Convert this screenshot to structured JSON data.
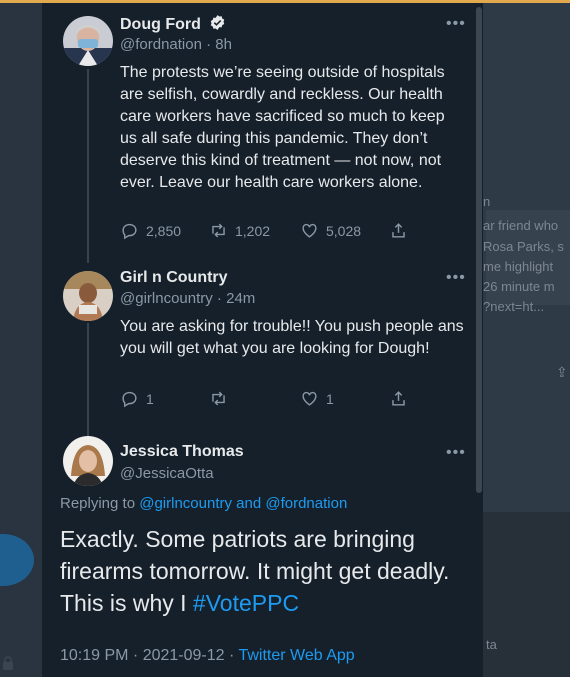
{
  "background": {
    "snippets": [
      "n",
      "ar friend who",
      "Rosa Parks, s",
      "me highlight",
      "26 minute m",
      "?next=ht..."
    ],
    "bottom_text": "ta"
  },
  "tweets": [
    {
      "name": "Doug Ford",
      "verified": true,
      "handle": "@fordnation",
      "time": "8h",
      "text": "The protests we’re seeing outside of hospitals are selfish, cowardly and reckless. Our health care workers have sacrificed so much to keep us all safe during this pandemic. They don’t deserve this kind of treatment — not now, not ever. Leave our health care workers alone.",
      "replies": "2,850",
      "retweets": "1,202",
      "likes": "5,028"
    },
    {
      "name": "Girl n Country",
      "handle": "@girlncountry",
      "time": "24m",
      "text": "You are asking for trouble!! You push people ans you will get what you are looking for Dough!",
      "replies": "1",
      "retweets": "",
      "likes": "1"
    }
  ],
  "focused_tweet": {
    "name": "Jessica Thomas",
    "handle": "@JessicaOtta",
    "replying_label": "Replying to",
    "replying_to_1": "@girlncountry",
    "replying_and": "and",
    "replying_to_2": "@fordnation",
    "text": "Exactly. Some patriots are bringing firearms tomorrow. It might get deadly. This is why I",
    "hashtag": "#VotePPC",
    "time": "10:19 PM",
    "date": "2021-09-12",
    "source": "Twitter Web App"
  },
  "colors": {
    "background": "#15202b",
    "accent": "#1d9bf0",
    "muted": "#8b98a5",
    "text": "#e7e9ea"
  },
  "icons": [
    "verified-badge-icon",
    "more-icon",
    "reply-icon",
    "retweet-icon",
    "like-icon",
    "share-icon"
  ]
}
